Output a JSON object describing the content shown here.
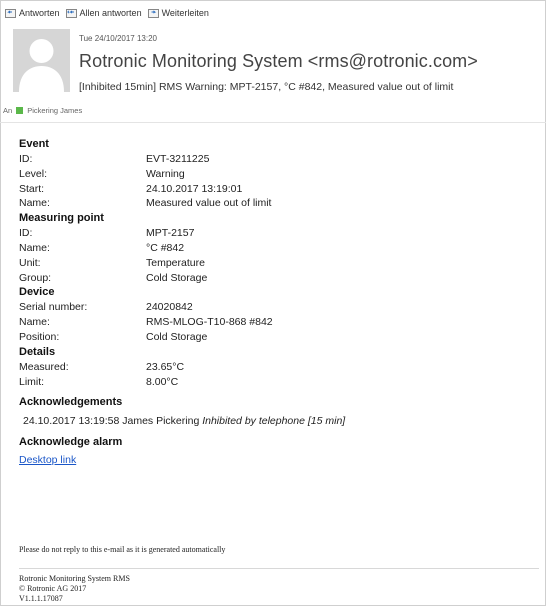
{
  "toolbar": {
    "reply_label": "Antworten",
    "reply_all_label": "Allen antworten",
    "forward_label": "Weiterleiten"
  },
  "header": {
    "date": "Tue 24/10/2017 13:20",
    "sender": "Rotronic Monitoring System <rms@rotronic.com>",
    "subject": "[Inhibited 15min] RMS Warning: MPT-2157, °C #842, Measured value out of limit",
    "to_label": "An",
    "to_name": "Pickering James",
    "to_color": "#5bb84a"
  },
  "event": {
    "title": "Event",
    "rows": [
      {
        "k": "ID:",
        "v": "EVT-3211225"
      },
      {
        "k": "Level:",
        "v": "Warning"
      },
      {
        "k": "Start:",
        "v": "24.10.2017 13:19:01"
      },
      {
        "k": "Name:",
        "v": "Measured value out of limit"
      }
    ]
  },
  "measuring_point": {
    "title": "Measuring point",
    "rows": [
      {
        "k": "ID:",
        "v": "MPT-2157"
      },
      {
        "k": "Name:",
        "v": "°C #842"
      },
      {
        "k": "Unit:",
        "v": "Temperature"
      },
      {
        "k": "Group:",
        "v": "Cold Storage"
      }
    ]
  },
  "device": {
    "title": "Device",
    "rows": [
      {
        "k": "Serial number:",
        "v": "24020842"
      },
      {
        "k": "Name:",
        "v": "RMS-MLOG-T10-868 #842"
      },
      {
        "k": "Position:",
        "v": "Cold Storage"
      }
    ]
  },
  "details": {
    "title": "Details",
    "rows": [
      {
        "k": "Measured:",
        "v": "23.65°C"
      },
      {
        "k": "Limit:",
        "v": "8.00°C"
      }
    ]
  },
  "acknowledgements": {
    "title": "Acknowledgements",
    "line_main": "24.10.2017 13:19:58 James Pickering ",
    "line_italic": "Inhibited by telephone [15 min]"
  },
  "acknowledge_alarm": {
    "title": "Acknowledge alarm",
    "link": "Desktop link"
  },
  "reply_note": "Please do not reply to this e-mail as it is generated automatically",
  "footer": {
    "line1": "Rotronic Monitoring System RMS",
    "line2": "© Rotronic AG 2017",
    "line3": "V1.1.1.17087"
  }
}
